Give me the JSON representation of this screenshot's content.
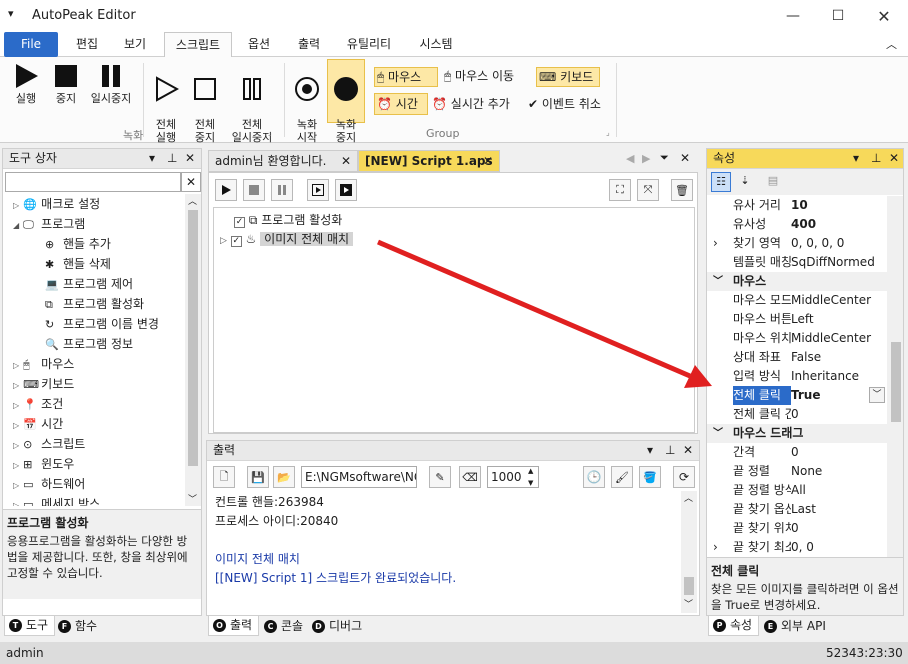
{
  "app": {
    "title": "AutoPeak Editor"
  },
  "menu": {
    "file": "File",
    "tabs": [
      "편집",
      "보기",
      "스크립트",
      "옵션",
      "출력",
      "유틸리티",
      "시스템"
    ]
  },
  "ribbon": {
    "rec_group": {
      "run": "실행",
      "stop": "중지",
      "pause": "일시중지",
      "run_all": "전체\n실행",
      "stop_all": "전체\n중지",
      "pause_all": "전체\n일시중지",
      "label": "녹화"
    },
    "group2": {
      "rec_start": "녹화\n시작",
      "rec_stop": "녹화\n중지",
      "mouse": "마우스",
      "mouse_move": "마우스 이동",
      "keyboard": "키보드",
      "time": "시간",
      "realtime": "실시간 추가",
      "cancel_event": "이벤트 취소",
      "label": "Group"
    }
  },
  "toolbox": {
    "title": "도구 상자",
    "search_placeholder": "",
    "items": [
      {
        "label": "매크로 설정",
        "level": 0,
        "expander": "▷"
      },
      {
        "label": "프로그램",
        "level": 0,
        "expander": "◢"
      },
      {
        "label": "핸들 추가",
        "level": 1
      },
      {
        "label": "핸들 삭제",
        "level": 1
      },
      {
        "label": "프로그램 제어",
        "level": 1
      },
      {
        "label": "프로그램 활성화",
        "level": 1
      },
      {
        "label": "프로그램 이름 변경",
        "level": 1
      },
      {
        "label": "프로그램 정보",
        "level": 1
      },
      {
        "label": "마우스",
        "level": 0,
        "expander": "▷"
      },
      {
        "label": "키보드",
        "level": 0,
        "expander": "▷"
      },
      {
        "label": "조건",
        "level": 0,
        "expander": "▷"
      },
      {
        "label": "시간",
        "level": 0,
        "expander": "▷"
      },
      {
        "label": "스크립트",
        "level": 0,
        "expander": "▷"
      },
      {
        "label": "윈도우",
        "level": 0,
        "expander": "▷"
      },
      {
        "label": "하드웨어",
        "level": 0,
        "expander": "▷"
      },
      {
        "label": "메세지 박스",
        "level": 0,
        "expander": "▷"
      }
    ],
    "desc_title": "프로그램 활성화",
    "desc_body": "응용프로그램을 활성화하는 다양한 방법을 제공합니다. 또한, 창을 최상위에 고정할 수 있습니다.",
    "tabs": [
      {
        "key": "T",
        "label": "도구"
      },
      {
        "key": "F",
        "label": "함수"
      }
    ]
  },
  "editor": {
    "tabs": [
      "admin님 환영합니다.",
      "[NEW] Script 1.aps"
    ],
    "rows": [
      {
        "label": "프로그램 활성화",
        "checked": true
      },
      {
        "label": "이미지 전체 매치",
        "checked": true
      }
    ]
  },
  "output": {
    "title": "출력",
    "path_value": "E:\\NGMsoftware\\NG",
    "count_value": "1000",
    "lines": [
      {
        "text": "컨트롤 핸들:263984",
        "color": "#1e1e1e"
      },
      {
        "text": "프로세스 아이디:20840",
        "color": "#1e1e1e"
      },
      {
        "text": "",
        "color": "#1e1e1e"
      },
      {
        "text": "이미지 전체 매치",
        "color": "#1a3aa8"
      },
      {
        "text": "[[NEW] Script 1] 스크립트가 완료되었습니다.",
        "color": "#1a3aa8"
      }
    ],
    "tabs": [
      {
        "key": "O",
        "label": "출력"
      },
      {
        "key": "C",
        "label": "콘솔"
      },
      {
        "key": "D",
        "label": "디버그"
      }
    ]
  },
  "properties": {
    "title": "속성",
    "rows": [
      {
        "name": "유사 거리",
        "value": "10",
        "bold": true,
        "type": "prop"
      },
      {
        "name": "유사성",
        "value": "400",
        "bold": true,
        "type": "prop"
      },
      {
        "name": "찾기 영역",
        "value": "0, 0, 0, 0",
        "type": "prop",
        "expander": "›"
      },
      {
        "name": "템플릿 매칭",
        "value": "SqDiffNormed",
        "type": "prop"
      },
      {
        "name": "마우스",
        "type": "cat"
      },
      {
        "name": "마우스 모드",
        "value": "MiddleCenter",
        "type": "prop"
      },
      {
        "name": "마우스 버튼",
        "value": "Left",
        "type": "prop"
      },
      {
        "name": "마우스 위치",
        "value": "MiddleCenter",
        "type": "prop"
      },
      {
        "name": "상대 좌표",
        "value": "False",
        "type": "prop"
      },
      {
        "name": "입력 방식",
        "value": "Inheritance",
        "type": "prop"
      },
      {
        "name": "전체 클릭",
        "value": "True",
        "bold": true,
        "type": "prop",
        "selected": true
      },
      {
        "name": "전체 클릭 간격",
        "value": "0",
        "type": "prop"
      },
      {
        "name": "마우스 드래그",
        "type": "cat"
      },
      {
        "name": "간격",
        "value": "0",
        "type": "prop"
      },
      {
        "name": "끝 정렬",
        "value": "None",
        "type": "prop"
      },
      {
        "name": "끝 정렬 방식",
        "value": "All",
        "type": "prop"
      },
      {
        "name": "끝 찾기 옵션",
        "value": "Last",
        "type": "prop"
      },
      {
        "name": "끝 찾기 위치",
        "value": "0",
        "type": "prop"
      },
      {
        "name": "끝 찾기 최소",
        "value": "0, 0",
        "type": "prop",
        "expander": "›"
      }
    ],
    "desc_title": "전체 클릭",
    "desc_body": "찾은 모든 이미지를 클릭하려면 이 옵션을 True로 변경하세요.",
    "tabs": [
      {
        "key": "P",
        "label": "속성"
      },
      {
        "key": "E",
        "label": "외부 API"
      }
    ]
  },
  "status": {
    "user": "admin",
    "time": "52343:23:30"
  },
  "colors": {
    "accent": "#2b6bc9",
    "highlight": "#f7d95a",
    "arrow": "#e02020"
  }
}
